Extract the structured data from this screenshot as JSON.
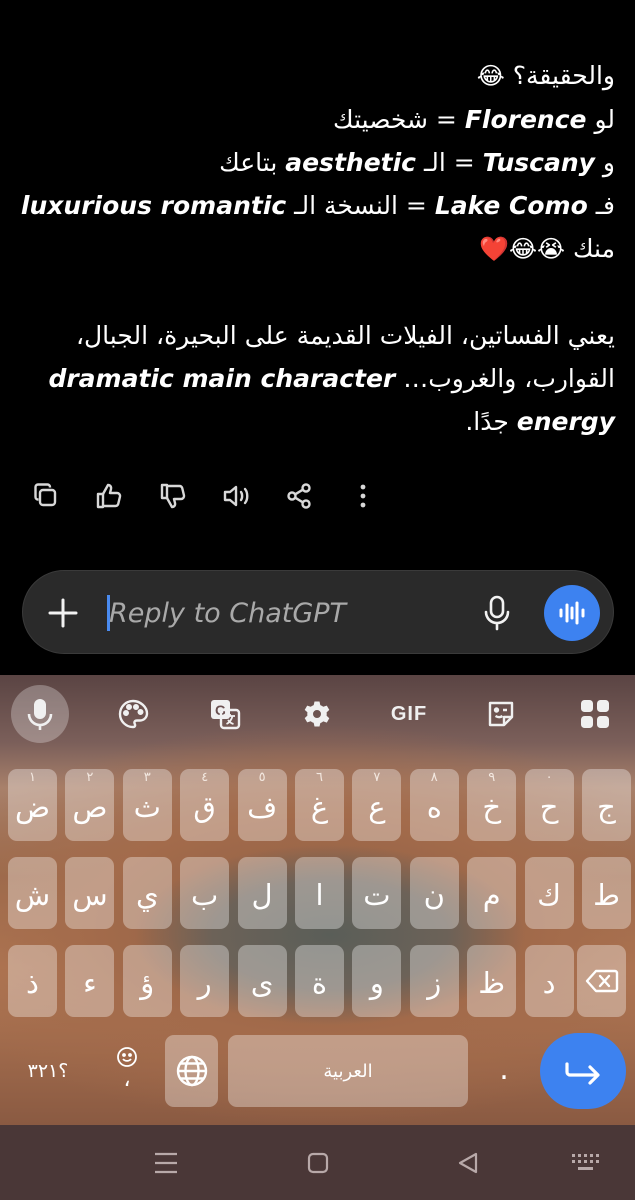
{
  "message": {
    "l1_text": "والحقيقة؟",
    "l1_emoji": "😂",
    "l2_ar1": "لو",
    "l2_en": "Florence",
    "l2_ar2": "= شخصيتك",
    "l3_ar1": "و",
    "l3_en1": "Tuscany",
    "l3_ar2": "= الـ",
    "l3_en2": "aesthetic",
    "l3_ar3": "بتاعك",
    "l4_ar1": "فـ",
    "l4_en1": "Lake Como",
    "l4_ar2": "= النسخة الـ",
    "l4_en2": "luxurious romantic",
    "l5_text": "منك",
    "l5_emoji": "😭😂❤️",
    "p2_l1": "يعني الفساتين، الفيلات القديمة على البحيرة، الجبال،",
    "p2_l2_ar": "القوارب، والغروب…",
    "p2_l2_en": "dramatic main character",
    "p2_l3_en": "energy",
    "p2_l3_ar": "جدًا."
  },
  "actions": [
    "copy-icon",
    "thumbs-up-icon",
    "thumbs-down-icon",
    "speaker-icon",
    "share-icon",
    "more-icon"
  ],
  "composer": {
    "placeholder": "Reply to ChatGPT"
  },
  "keyboard": {
    "toolbar": {
      "gif": "GIF"
    },
    "row1": [
      {
        "ch": "ض",
        "hint": "١"
      },
      {
        "ch": "ص",
        "hint": "٢"
      },
      {
        "ch": "ث",
        "hint": "٣"
      },
      {
        "ch": "ق",
        "hint": "٤"
      },
      {
        "ch": "ف",
        "hint": "٥"
      },
      {
        "ch": "غ",
        "hint": "٦"
      },
      {
        "ch": "ع",
        "hint": "٧"
      },
      {
        "ch": "ه",
        "hint": "٨"
      },
      {
        "ch": "خ",
        "hint": "٩"
      },
      {
        "ch": "ح",
        "hint": "٠"
      },
      {
        "ch": "ج",
        "hint": ""
      }
    ],
    "row2": [
      "ش",
      "س",
      "ي",
      "ب",
      "ل",
      "ا",
      "ت",
      "ن",
      "م",
      "ك",
      "ط"
    ],
    "row3": [
      "ذ",
      "ء",
      "ؤ",
      "ر",
      "ى",
      "ة",
      "و",
      "ز",
      "ظ",
      "د"
    ],
    "symbols_key": "؟٣٢١",
    "emoji_comma": "،",
    "space_label": "العربية",
    "period_key": ".",
    "colors": {
      "accent": "#3d82f0"
    }
  }
}
